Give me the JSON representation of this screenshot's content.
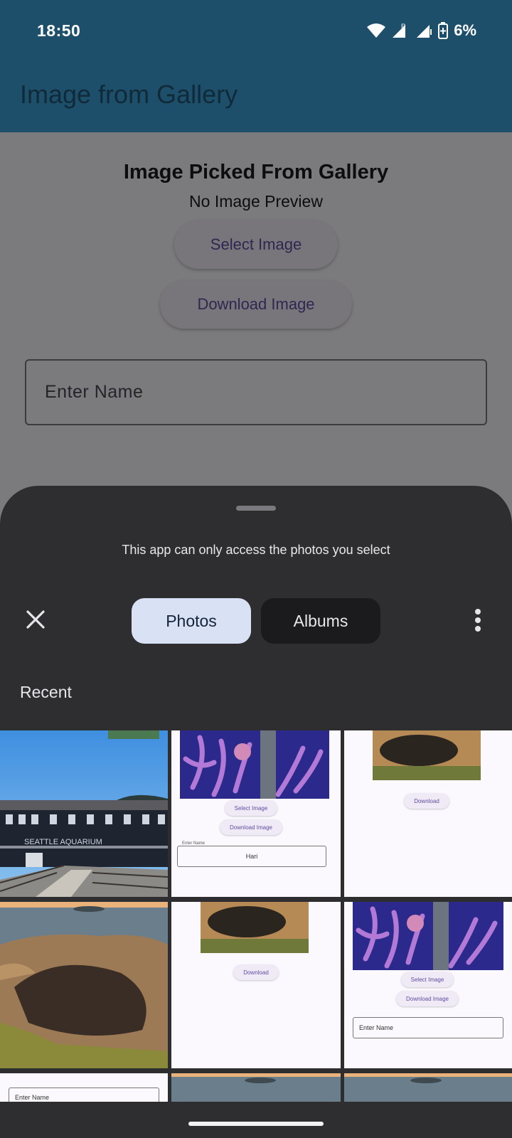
{
  "status_bar": {
    "time": "18:50",
    "battery": "6%",
    "signal_label": "R"
  },
  "app_bar": {
    "title": "Image from Gallery"
  },
  "app_content": {
    "heading": "Image Picked From Gallery",
    "subheading": "No Image Preview",
    "select_label": "Select Image",
    "download_label": "Download Image",
    "name_placeholder": "Enter Name"
  },
  "picker": {
    "message": "This app can only access the photos you select",
    "tabs": [
      {
        "label": "Photos",
        "selected": true
      },
      {
        "label": "Albums",
        "selected": false
      }
    ],
    "section_title": "Recent",
    "thumbnails": [
      {
        "kind": "photo",
        "subject": "aquarium building",
        "sign_text": "SEATTLE AQUARIUM"
      },
      {
        "kind": "screenshot",
        "select_label": "Select Image",
        "download_label": "Download Image",
        "field_label": "Enter Name",
        "field_value": "Hari"
      },
      {
        "kind": "screenshot",
        "download_label": "Download"
      },
      {
        "kind": "photo",
        "subject": "coastal rock formation"
      },
      {
        "kind": "screenshot",
        "download_label": "Download"
      },
      {
        "kind": "screenshot",
        "select_label": "Select Image",
        "download_label": "Download Image",
        "field_placeholder": "Enter Name"
      },
      {
        "kind": "screenshot",
        "field_placeholder": "Enter Name"
      },
      {
        "kind": "photo",
        "subject": "ocean"
      },
      {
        "kind": "photo",
        "subject": "ocean"
      }
    ]
  },
  "colors": {
    "app_bar": "#1d4f6b",
    "sheet": "#2e2e30",
    "selected_tab": "#d9e2f5",
    "unselected_tab": "#1b1b1d",
    "button_text": "#5f4fa3"
  }
}
